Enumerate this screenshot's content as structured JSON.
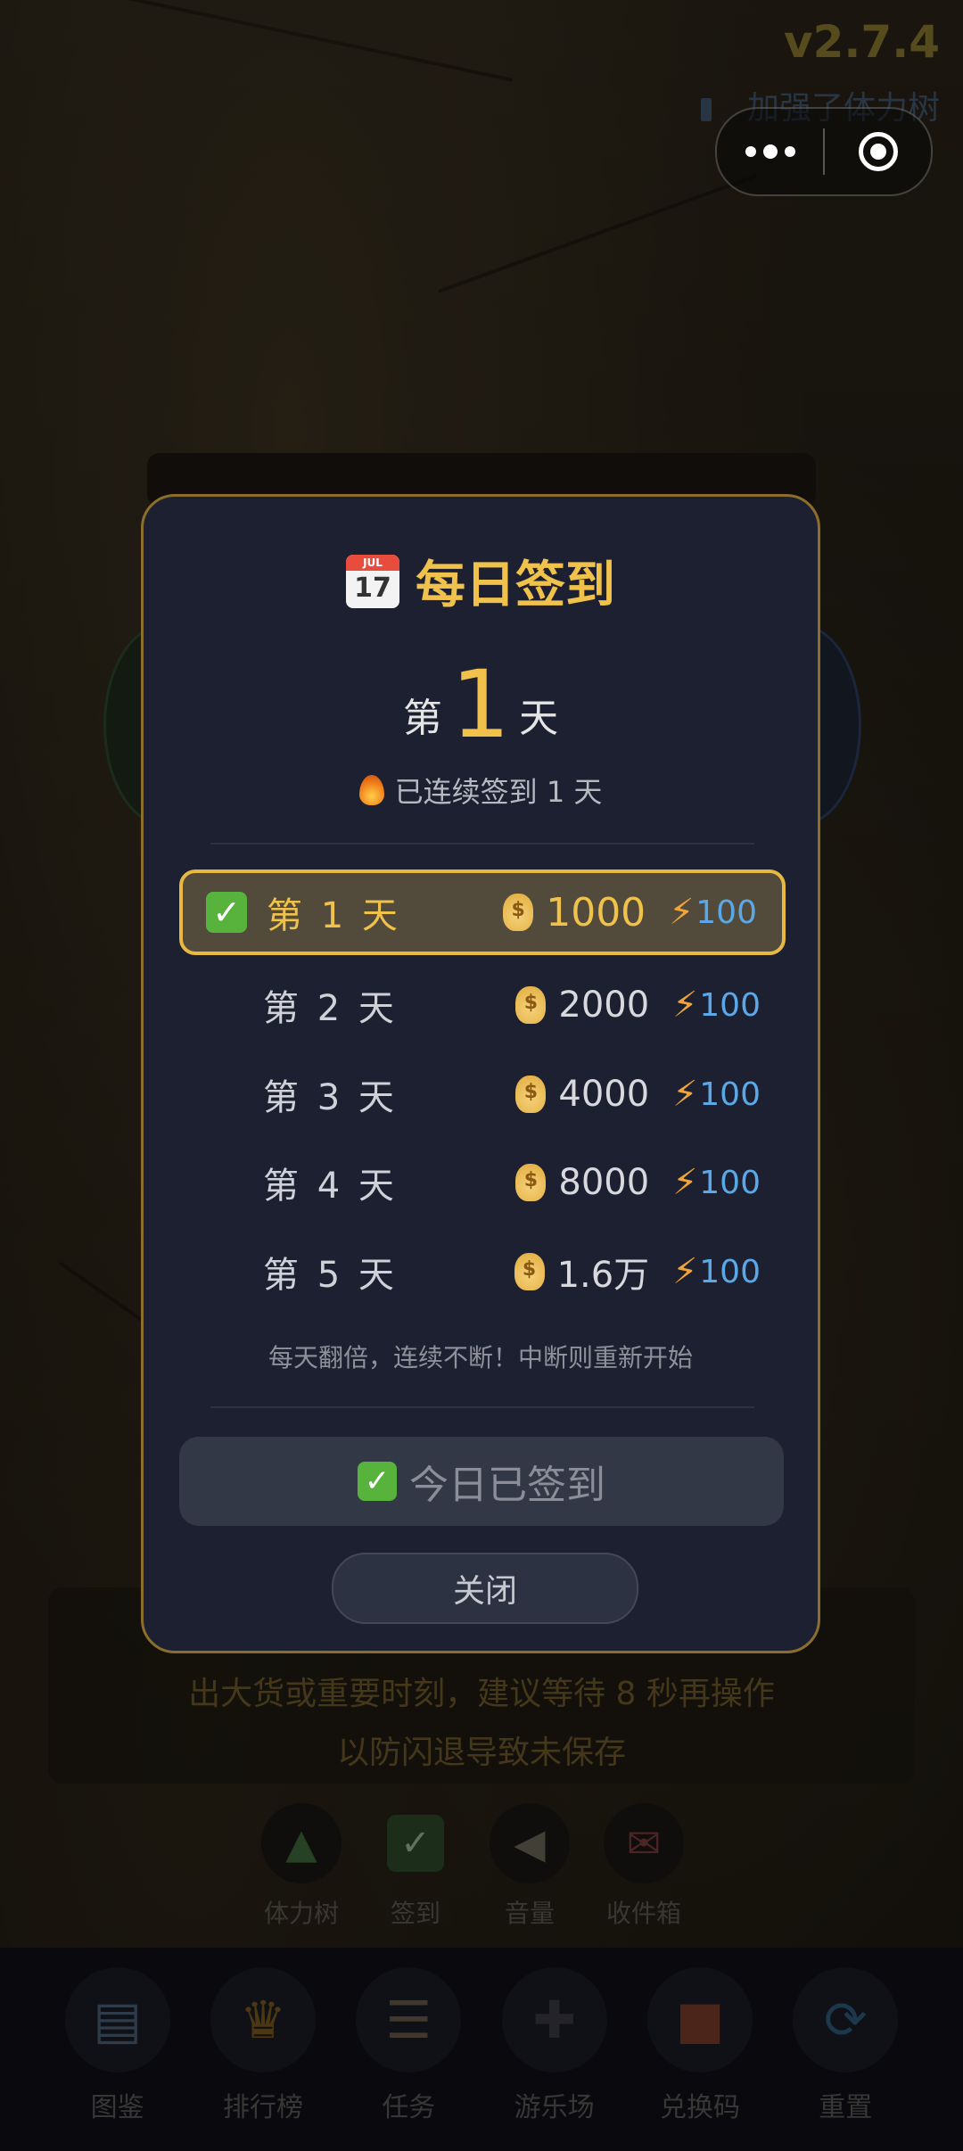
{
  "header": {
    "version": "v2.7.4",
    "note": "加强了体力树"
  },
  "background": {
    "warning_line1": "出大货或重要时刻，建议等待 8 秒再操作",
    "warning_line2": "以防闪退导致未保存"
  },
  "quick_actions": [
    {
      "label": "体力树",
      "icon": "tree-icon"
    },
    {
      "label": "签到",
      "icon": "checkmark-icon"
    },
    {
      "label": "音量",
      "icon": "speaker-icon"
    },
    {
      "label": "收件箱",
      "icon": "mailbox-icon"
    }
  ],
  "bottom_nav": [
    {
      "label": "图鉴",
      "icon": "book-icon"
    },
    {
      "label": "排行榜",
      "icon": "trophy-icon"
    },
    {
      "label": "任务",
      "icon": "clipboard-icon"
    },
    {
      "label": "游乐场",
      "icon": "gamepad-icon"
    },
    {
      "label": "兑换码",
      "icon": "gift-icon"
    },
    {
      "label": "重置",
      "icon": "refresh-icon"
    }
  ],
  "modal": {
    "title": "每日签到",
    "calendar_icon_month": "JUL",
    "calendar_icon_day": "17",
    "day_prefix": "第",
    "day_number": "1",
    "day_suffix": "天",
    "streak_text": "已连续签到 1 天",
    "rewards": [
      {
        "label": "第 1 天",
        "coins": "1000",
        "energy": "100",
        "active": true
      },
      {
        "label": "第 2 天",
        "coins": "2000",
        "energy": "100",
        "active": false
      },
      {
        "label": "第 3 天",
        "coins": "4000",
        "energy": "100",
        "active": false
      },
      {
        "label": "第 4 天",
        "coins": "8000",
        "energy": "100",
        "active": false
      },
      {
        "label": "第 5 天",
        "coins": "1.6万",
        "energy": "100",
        "active": false
      }
    ],
    "tip": "每天翻倍，连续不断！中断则重新开始",
    "signed_button": "今日已签到",
    "close_button": "关闭"
  },
  "colors": {
    "accent_gold": "#f0c24b",
    "energy_blue": "#5aa8e8",
    "check_green": "#57b33c"
  }
}
